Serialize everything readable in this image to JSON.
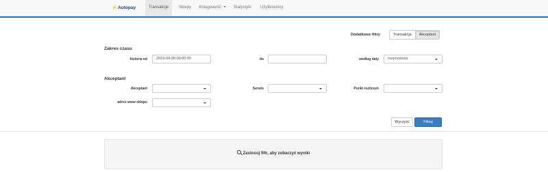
{
  "brand": {
    "name": "Autopay"
  },
  "nav": {
    "items": [
      {
        "label": "Transakcje",
        "active": true
      },
      {
        "label": "Sklepy",
        "active": false
      },
      {
        "label": "Księgowość",
        "active": false,
        "has_dropdown": true
      },
      {
        "label": "Statystyki",
        "active": false
      },
      {
        "label": "Użytkownicy",
        "active": false
      }
    ]
  },
  "extra_filters": {
    "label": "Dodatkowe filtry",
    "buttons": [
      "Transakcja",
      "Akceptant"
    ],
    "active": "Akceptant"
  },
  "time_range": {
    "title": "Zakres czasu",
    "from_label": "historia od",
    "from_value": "2019-04-20 00:00:00",
    "to_label": "do",
    "to_value": "",
    "by_date_label": "według daty",
    "by_date_value": "rozpoczęcia"
  },
  "acceptor": {
    "title": "Akceptant",
    "acceptor_label": "Akceptant",
    "acceptor_value": "",
    "service_label": "Serwis",
    "service_value": "",
    "settlement_label": "Punkt rozliczeń",
    "settlement_value": "",
    "shop_url_label": "adres www sklepu",
    "shop_url_value": ""
  },
  "actions": {
    "clear": "Wyczyść",
    "filter": "Filtruj"
  },
  "results": {
    "message": "Zastosuj filtr, aby zobaczyć wyniki"
  },
  "colors": {
    "primary": "#3a7dc3",
    "nav_active": "#e7e7e7",
    "accent_line": "#2f6fb3"
  }
}
